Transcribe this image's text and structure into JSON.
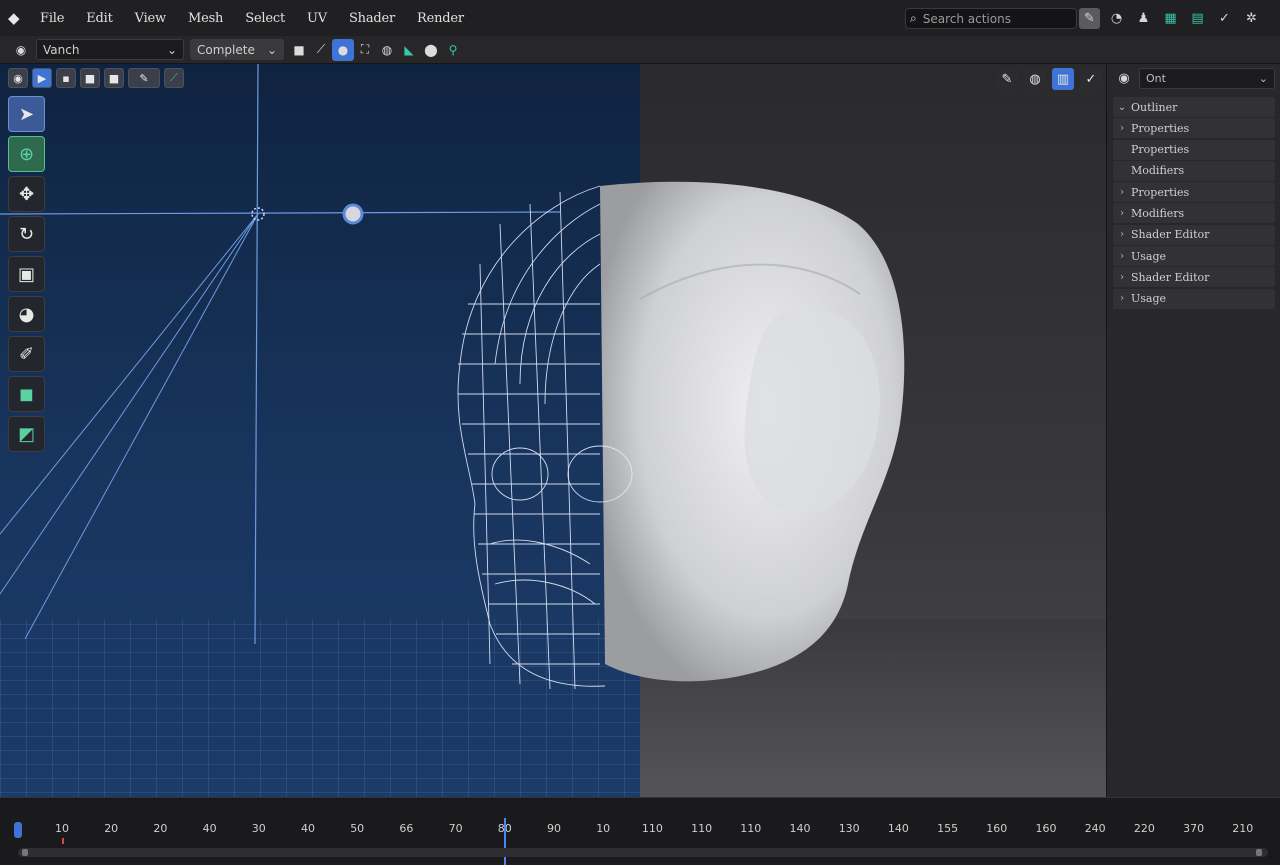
{
  "menubar": {
    "logo_icon": "blender-icon",
    "items": [
      "File",
      "Edit",
      "View",
      "Mesh",
      "Select",
      "UV",
      "Shader",
      "Render"
    ],
    "search_placeholder": "Search actions"
  },
  "toolbar": {
    "mode_dropdown": "Vanch",
    "complete_dropdown": "Complete"
  },
  "right_panel": {
    "header_dropdown": "Ont",
    "items": [
      {
        "label": "Outliner",
        "chevron": "expanded"
      },
      {
        "label": "Properties",
        "chevron": "collapsed"
      },
      {
        "label": "Properties",
        "chevron": "none"
      },
      {
        "label": "Modifiers",
        "chevron": "none"
      },
      {
        "label": "Properties",
        "chevron": "collapsed"
      },
      {
        "label": "Modifiers",
        "chevron": "collapsed"
      },
      {
        "label": "Shader Editor",
        "chevron": "collapsed"
      },
      {
        "label": "Usage",
        "chevron": "collapsed"
      },
      {
        "label": "Shader Editor",
        "chevron": "collapsed"
      },
      {
        "label": "Usage",
        "chevron": "collapsed"
      }
    ]
  },
  "timeline": {
    "tick_labels": [
      "10",
      "20",
      "20",
      "40",
      "30",
      "40",
      "50",
      "66",
      "70",
      "80",
      "90",
      "10",
      "110",
      "110",
      "110",
      "140",
      "130",
      "140",
      "155",
      "160",
      "160",
      "240",
      "220",
      "370",
      "210"
    ],
    "current_frame_label": "80"
  },
  "colors": {
    "accent": "#3e73d8",
    "viewport_blue": "#18355e",
    "panel_bg": "#28282b"
  }
}
